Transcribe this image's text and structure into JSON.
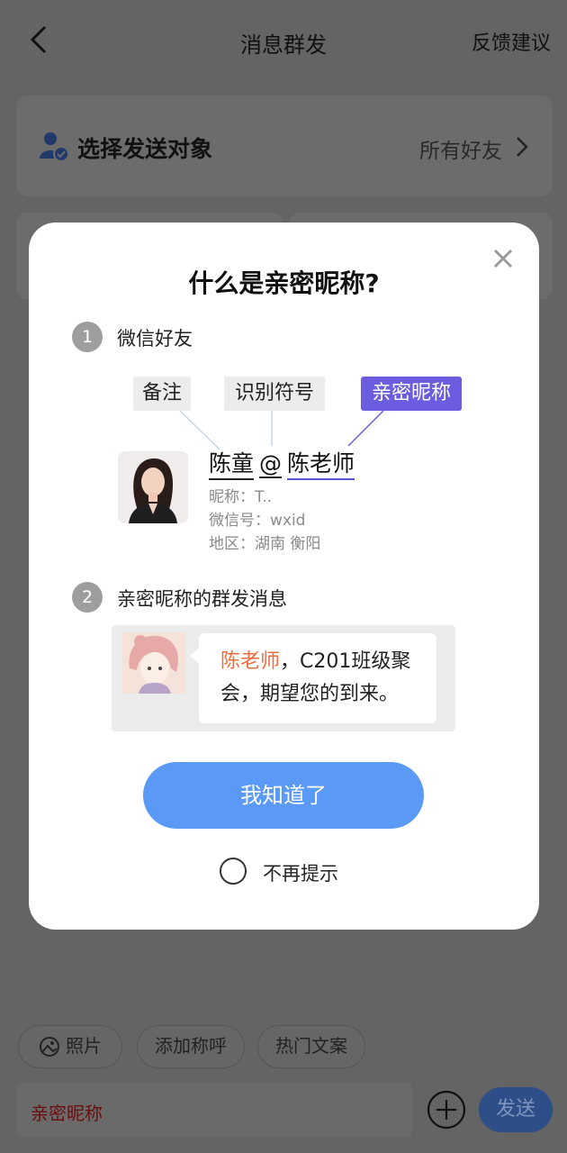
{
  "header": {
    "title": "消息群发",
    "feedback_label": "反馈建议"
  },
  "recipient": {
    "label": "选择发送对象",
    "value": "所有好友"
  },
  "bottom": {
    "chips": [
      "照片",
      "添加称呼",
      "热门文案"
    ],
    "input_text": "亲密昵称",
    "send_label": "发送"
  },
  "modal": {
    "title": "什么是亲密昵称?",
    "step1": {
      "number": "1",
      "label": "微信好友"
    },
    "tags": {
      "remark": "备注",
      "symbol": "识别符号",
      "intimate": "亲密昵称"
    },
    "profile": {
      "remark": "陈童",
      "symbol": "@",
      "intimate_nick": "陈老师",
      "nickname": "昵称：T..",
      "wechat_id": "微信号：wxid",
      "region": "地区：湖南 衡阳"
    },
    "step2": {
      "number": "2",
      "label": "亲密昵称的群发消息"
    },
    "message": {
      "mention": "陈老师",
      "text": "，C201班级聚会，期望您的到来。"
    },
    "ok_label": "我知道了",
    "no_remind_label": "不再提示"
  },
  "colors": {
    "accent_blue": "#5a99f6",
    "intimate_purple": "#6b5ce0",
    "mention_orange": "#ee6b3c"
  }
}
